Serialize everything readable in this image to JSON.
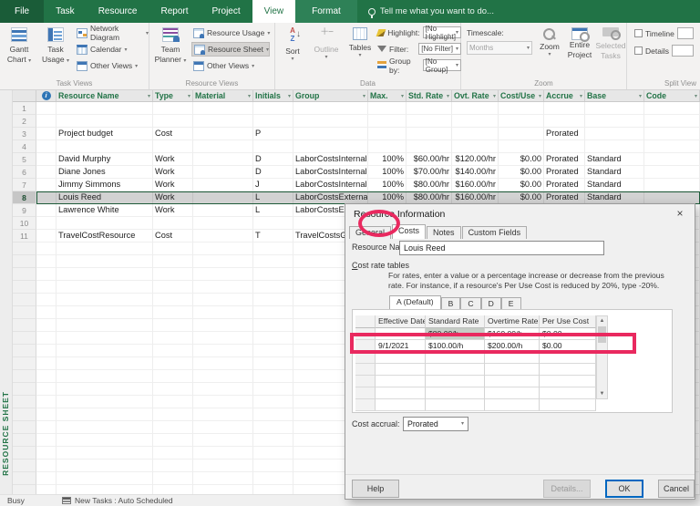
{
  "app": {
    "tabs": [
      "File",
      "Task",
      "Resource",
      "Report",
      "Project",
      "View",
      "Format"
    ],
    "active_tab": "View",
    "tell_me": "Tell me what you want to do..."
  },
  "ribbon": {
    "group_labels": {
      "task_views": "Task Views",
      "resource_views": "Resource Views",
      "data": "Data",
      "zoom": "Zoom",
      "split_view": "Split View"
    },
    "task_views": {
      "gantt_chart_line1": "Gantt",
      "gantt_chart_line2": "Chart",
      "task_usage_line1": "Task",
      "task_usage_line2": "Usage",
      "network_diagram": "Network Diagram",
      "calendar": "Calendar",
      "other_views": "Other Views"
    },
    "resource_views": {
      "team_planner_line1": "Team",
      "team_planner_line2": "Planner",
      "resource_usage": "Resource Usage",
      "resource_sheet": "Resource Sheet",
      "other_views": "Other Views"
    },
    "data_group": {
      "sort": "Sort",
      "outline": "Outline",
      "tables": "Tables",
      "highlight_label": "Highlight:",
      "highlight_value": "[No Highlight]",
      "filter_label": "Filter:",
      "filter_value": "[No Filter]",
      "group_by_label": "Group by:",
      "group_by_value": "[No Group]"
    },
    "zoom_group": {
      "timescale_label": "Timescale:",
      "timescale_value": "Months",
      "zoom": "Zoom",
      "entire_line1": "Entire",
      "entire_line2": "Project",
      "selected_line1": "Selected",
      "selected_line2": "Tasks"
    },
    "split_view": {
      "timeline": "Timeline",
      "details": "Details"
    }
  },
  "sheet": {
    "view_label": "RESOURCE SHEET",
    "selected_row": "8",
    "columns": [
      {
        "key": "name",
        "label": "Resource Name"
      },
      {
        "key": "type",
        "label": "Type"
      },
      {
        "key": "material",
        "label": "Material"
      },
      {
        "key": "initials",
        "label": "Initials"
      },
      {
        "key": "group",
        "label": "Group"
      },
      {
        "key": "max",
        "label": "Max."
      },
      {
        "key": "std",
        "label": "Std. Rate"
      },
      {
        "key": "ovt",
        "label": "Ovt. Rate"
      },
      {
        "key": "cost_use",
        "label": "Cost/Use"
      },
      {
        "key": "accrue",
        "label": "Accrue"
      },
      {
        "key": "base",
        "label": "Base"
      },
      {
        "key": "code",
        "label": "Code"
      }
    ],
    "rows": [
      {
        "num": "1"
      },
      {
        "num": "2"
      },
      {
        "num": "3",
        "name": "Project budget",
        "type": "Cost",
        "initials": "P",
        "accrue": "Prorated"
      },
      {
        "num": "4"
      },
      {
        "num": "5",
        "name": "David Murphy",
        "type": "Work",
        "initials": "D",
        "group": "LaborCostsInternal",
        "max": "100%",
        "std": "$60.00/hr",
        "ovt": "$120.00/hr",
        "cost_use": "$0.00",
        "accrue": "Prorated",
        "base": "Standard"
      },
      {
        "num": "6",
        "name": "Diane Jones",
        "type": "Work",
        "initials": "D",
        "group": "LaborCostsInternal",
        "max": "100%",
        "std": "$70.00/hr",
        "ovt": "$140.00/hr",
        "cost_use": "$0.00",
        "accrue": "Prorated",
        "base": "Standard"
      },
      {
        "num": "7",
        "name": "Jimmy Simmons",
        "type": "Work",
        "initials": "J",
        "group": "LaborCostsInternal",
        "max": "100%",
        "std": "$80.00/hr",
        "ovt": "$160.00/hr",
        "cost_use": "$0.00",
        "accrue": "Prorated",
        "base": "Standard"
      },
      {
        "num": "8",
        "name": "Louis Reed",
        "type": "Work",
        "initials": "L",
        "group": "LaborCostsExternal",
        "max": "100%",
        "std": "$80.00/hr",
        "ovt": "$160.00/hr",
        "cost_use": "$0.00",
        "accrue": "Prorated",
        "base": "Standard"
      },
      {
        "num": "9",
        "name": "Lawrence White",
        "type": "Work",
        "initials": "L",
        "group": "LaborCostsExternal"
      },
      {
        "num": "10"
      },
      {
        "num": "11",
        "name": "TravelCostResource",
        "type": "Cost",
        "initials": "T",
        "group": "TravelCostsGroup"
      }
    ]
  },
  "dialog": {
    "title": "Resource Information",
    "close": "×",
    "tabs": [
      "General",
      "Costs",
      "Notes",
      "Custom Fields"
    ],
    "active_tab": "Costs",
    "resource_name_label": "Resource Name:",
    "resource_name_value": "Louis Reed",
    "section_label": "Cost rate tables",
    "instructions_line1": "For rates, enter a value or a percentage increase or decrease from the previous",
    "instructions_line2": "rate. For instance, if a resource's Per Use Cost is reduced by 20%, type -20%.",
    "rate_tabs": [
      "A (Default)",
      "B",
      "C",
      "D",
      "E"
    ],
    "active_rate_tab": "A (Default)",
    "rate_table": {
      "headers": [
        "Effective Date",
        "Standard Rate",
        "Overtime Rate",
        "Per Use Cost"
      ],
      "rows": [
        [
          "--",
          "$80.00/h",
          "$160.00/h",
          "$0.00"
        ],
        [
          "9/1/2021",
          "$100.00/h",
          "$200.00/h",
          "$0.00"
        ],
        [
          "",
          "",
          "",
          ""
        ],
        [
          "",
          "",
          "",
          ""
        ],
        [
          "",
          "",
          "",
          ""
        ],
        [
          "",
          "",
          "",
          ""
        ],
        [
          "",
          "",
          "",
          ""
        ]
      ]
    },
    "cost_accrual_label": "Cost accrual:",
    "cost_accrual_value": "Prorated",
    "buttons": {
      "help": "Help",
      "details": "Details...",
      "ok": "OK",
      "cancel": "Cancel"
    }
  },
  "status_bar": {
    "left": "Busy",
    "new_tasks": "New Tasks : Auto Scheduled"
  },
  "colors": {
    "accent_green": "#217346",
    "annotation": "#e9295f"
  }
}
